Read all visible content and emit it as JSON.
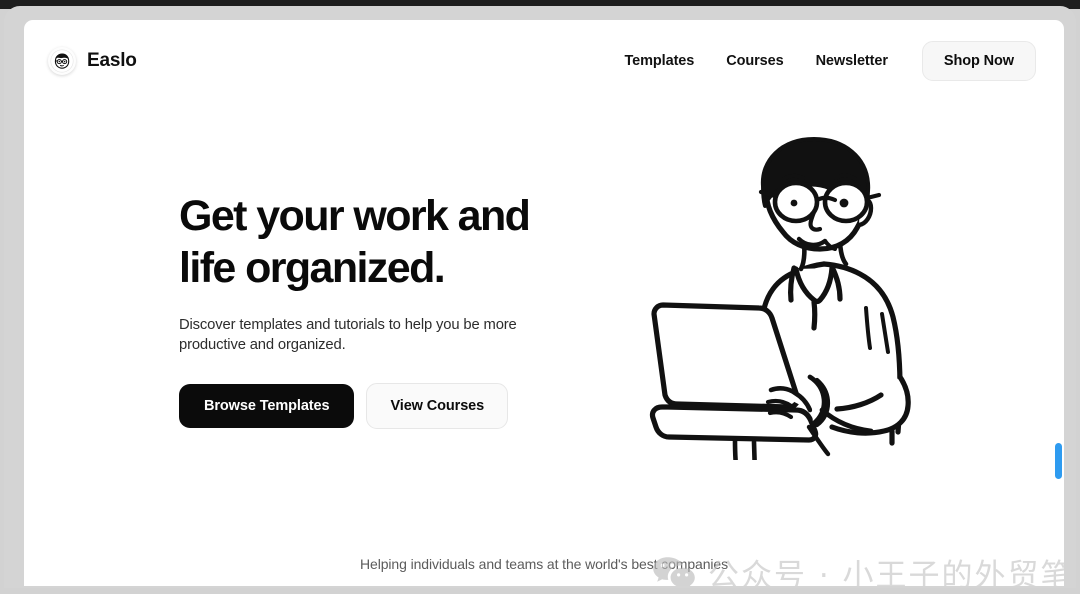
{
  "brand": {
    "name": "Easlo",
    "avatar_icon": "face-avatar-icon"
  },
  "nav": {
    "links": [
      {
        "label": "Templates"
      },
      {
        "label": "Courses"
      },
      {
        "label": "Newsletter"
      }
    ],
    "cta": {
      "label": "Shop Now"
    }
  },
  "hero": {
    "title": "Get your work and\nlife organized.",
    "subtitle": "Discover templates and tutorials to help you be more\nproductive and organized.",
    "primary_button": "Browse Templates",
    "secondary_button": "View Courses",
    "illustration_icon": "person-with-laptop-illustration"
  },
  "footer": {
    "note": "Helping individuals and teams at the world's best companies"
  },
  "watermark": {
    "logo_icon": "wechat-icon",
    "text": "公众号 · 小王子的外贸笔记"
  },
  "scrollbar": {
    "thumb_color": "#2e9bf0"
  },
  "colors": {
    "page_background": "#ffffff",
    "frame": "#d4d4d4",
    "text_primary": "#0a0a0a",
    "text_muted": "#5c5c5c",
    "button_primary_bg": "#0b0b0b",
    "button_secondary_bg": "#fafafa"
  }
}
